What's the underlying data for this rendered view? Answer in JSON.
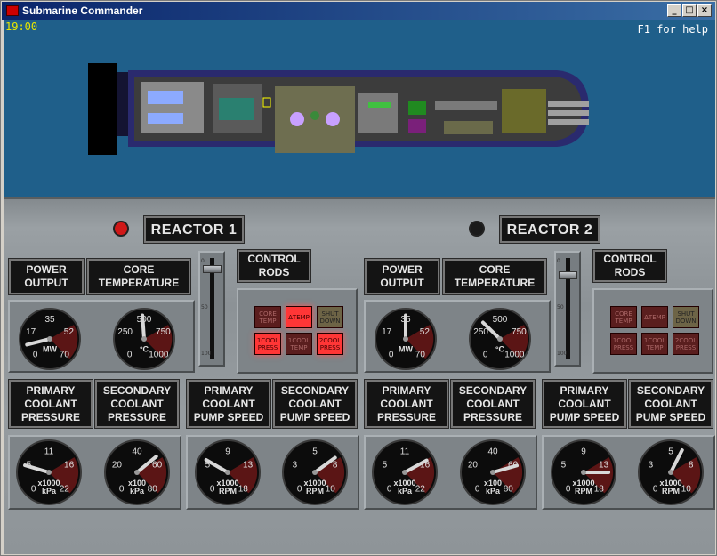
{
  "window": {
    "title": "Submarine Commander",
    "buttons": [
      "_",
      "□",
      "×"
    ]
  },
  "hud": {
    "clock": "19:00",
    "help": "F1 for help"
  },
  "reactors": [
    {
      "name": "REACTOR 1",
      "lamp_color": "#d01818",
      "labels": {
        "power": "POWER\nOUTPUT",
        "core": "CORE\nTEMPERATURE",
        "rods": "CONTROL\nRODS",
        "primary_pressure": "PRIMARY\nCOOLANT\nPRESSURE",
        "secondary_pressure": "SECONDARY\nCOOLANT\nPRESSURE",
        "primary_pump": "PRIMARY\nCOOLANT\nPUMP SPEED",
        "secondary_pump": "SECONDARY\nCOOLANT\nPUMP SPEED"
      },
      "rod_scale": [
        "0",
        "50",
        "100"
      ],
      "rod_level": 0.06,
      "buttons": [
        {
          "label": "CORE\nTEMP",
          "state": "off"
        },
        {
          "label": "ΔTEMP",
          "state": "on"
        },
        {
          "label": "SHUT\nDOWN",
          "state": "sd"
        },
        {
          "label": "1COOL\nPRESS",
          "state": "on"
        },
        {
          "label": "1COOL\nTEMP",
          "state": "off"
        },
        {
          "label": "2COOL\nPRESS",
          "state": "on"
        }
      ],
      "gauges": {
        "power": {
          "ticks": [
            "0",
            "17",
            "35",
            "52",
            "70"
          ],
          "unit": "MW",
          "value": 8
        },
        "core": {
          "ticks": [
            "0",
            "250",
            "500",
            "750",
            "1000"
          ],
          "unit": "°C",
          "value": 485
        },
        "primary_pressure": {
          "ticks": [
            "0",
            "5",
            "11",
            "16",
            "22"
          ],
          "unit": "x1000\nkPa",
          "value": 5
        },
        "secondary_pressure": {
          "ticks": [
            "0",
            "20",
            "40",
            "60",
            "80"
          ],
          "unit": "x100\nkPa",
          "value": 55
        },
        "primary_pump": {
          "ticks": [
            "0",
            "5",
            "9",
            "13",
            "18"
          ],
          "unit": "x1000\nRPM",
          "value": 5
        },
        "secondary_pump": {
          "ticks": [
            "0",
            "3",
            "5",
            "8",
            "10"
          ],
          "unit": "x1000\nRPM",
          "value": 7
        }
      }
    },
    {
      "name": "REACTOR 2",
      "lamp_color": "#1a1a1a",
      "labels": {
        "power": "POWER\nOUTPUT",
        "core": "CORE\nTEMPERATURE",
        "rods": "CONTROL\nRODS",
        "primary_pressure": "PRIMARY\nCOOLANT\nPRESSURE",
        "secondary_pressure": "SECONDARY\nCOOLANT\nPRESSURE",
        "primary_pump": "PRIMARY\nCOOLANT\nPUMP SPEED",
        "secondary_pump": "SECONDARY\nCOOLANT\nPUMP SPEED"
      },
      "rod_scale": [
        "0",
        "50",
        "100"
      ],
      "rod_level": 0.12,
      "buttons": [
        {
          "label": "CORE\nTEMP",
          "state": "off"
        },
        {
          "label": "ΔTEMP",
          "state": "off"
        },
        {
          "label": "SHUT\nDOWN",
          "state": "sd"
        },
        {
          "label": "1COOL\nPRESS",
          "state": "off"
        },
        {
          "label": "1COOL\nTEMP",
          "state": "off"
        },
        {
          "label": "2COOL\nPRESS",
          "state": "off"
        }
      ],
      "gauges": {
        "power": {
          "ticks": [
            "0",
            "17",
            "35",
            "52",
            "70"
          ],
          "unit": "MW",
          "value": 35
        },
        "core": {
          "ticks": [
            "0",
            "250",
            "500",
            "750",
            "1000"
          ],
          "unit": "°C",
          "value": 330
        },
        "primary_pressure": {
          "ticks": [
            "0",
            "5",
            "11",
            "16",
            "22"
          ],
          "unit": "x1000\nkPa",
          "value": 16
        },
        "secondary_pressure": {
          "ticks": [
            "0",
            "20",
            "40",
            "60",
            "80"
          ],
          "unit": "x100\nkPa",
          "value": 62
        },
        "primary_pump": {
          "ticks": [
            "0",
            "5",
            "9",
            "13",
            "18"
          ],
          "unit": "x1000\nRPM",
          "value": 15
        },
        "secondary_pump": {
          "ticks": [
            "0",
            "3",
            "5",
            "8",
            "10"
          ],
          "unit": "x1000\nRPM",
          "value": 6
        }
      }
    }
  ]
}
